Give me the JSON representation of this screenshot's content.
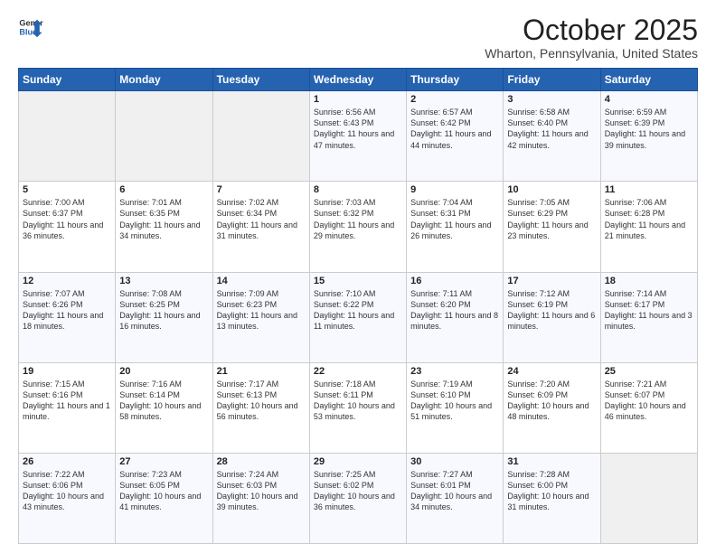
{
  "logo": {
    "line1": "General",
    "line2": "Blue"
  },
  "header": {
    "month": "October 2025",
    "location": "Wharton, Pennsylvania, United States"
  },
  "days_of_week": [
    "Sunday",
    "Monday",
    "Tuesday",
    "Wednesday",
    "Thursday",
    "Friday",
    "Saturday"
  ],
  "weeks": [
    [
      {
        "day": "",
        "info": ""
      },
      {
        "day": "",
        "info": ""
      },
      {
        "day": "",
        "info": ""
      },
      {
        "day": "1",
        "info": "Sunrise: 6:56 AM\nSunset: 6:43 PM\nDaylight: 11 hours and 47 minutes."
      },
      {
        "day": "2",
        "info": "Sunrise: 6:57 AM\nSunset: 6:42 PM\nDaylight: 11 hours and 44 minutes."
      },
      {
        "day": "3",
        "info": "Sunrise: 6:58 AM\nSunset: 6:40 PM\nDaylight: 11 hours and 42 minutes."
      },
      {
        "day": "4",
        "info": "Sunrise: 6:59 AM\nSunset: 6:39 PM\nDaylight: 11 hours and 39 minutes."
      }
    ],
    [
      {
        "day": "5",
        "info": "Sunrise: 7:00 AM\nSunset: 6:37 PM\nDaylight: 11 hours and 36 minutes."
      },
      {
        "day": "6",
        "info": "Sunrise: 7:01 AM\nSunset: 6:35 PM\nDaylight: 11 hours and 34 minutes."
      },
      {
        "day": "7",
        "info": "Sunrise: 7:02 AM\nSunset: 6:34 PM\nDaylight: 11 hours and 31 minutes."
      },
      {
        "day": "8",
        "info": "Sunrise: 7:03 AM\nSunset: 6:32 PM\nDaylight: 11 hours and 29 minutes."
      },
      {
        "day": "9",
        "info": "Sunrise: 7:04 AM\nSunset: 6:31 PM\nDaylight: 11 hours and 26 minutes."
      },
      {
        "day": "10",
        "info": "Sunrise: 7:05 AM\nSunset: 6:29 PM\nDaylight: 11 hours and 23 minutes."
      },
      {
        "day": "11",
        "info": "Sunrise: 7:06 AM\nSunset: 6:28 PM\nDaylight: 11 hours and 21 minutes."
      }
    ],
    [
      {
        "day": "12",
        "info": "Sunrise: 7:07 AM\nSunset: 6:26 PM\nDaylight: 11 hours and 18 minutes."
      },
      {
        "day": "13",
        "info": "Sunrise: 7:08 AM\nSunset: 6:25 PM\nDaylight: 11 hours and 16 minutes."
      },
      {
        "day": "14",
        "info": "Sunrise: 7:09 AM\nSunset: 6:23 PM\nDaylight: 11 hours and 13 minutes."
      },
      {
        "day": "15",
        "info": "Sunrise: 7:10 AM\nSunset: 6:22 PM\nDaylight: 11 hours and 11 minutes."
      },
      {
        "day": "16",
        "info": "Sunrise: 7:11 AM\nSunset: 6:20 PM\nDaylight: 11 hours and 8 minutes."
      },
      {
        "day": "17",
        "info": "Sunrise: 7:12 AM\nSunset: 6:19 PM\nDaylight: 11 hours and 6 minutes."
      },
      {
        "day": "18",
        "info": "Sunrise: 7:14 AM\nSunset: 6:17 PM\nDaylight: 11 hours and 3 minutes."
      }
    ],
    [
      {
        "day": "19",
        "info": "Sunrise: 7:15 AM\nSunset: 6:16 PM\nDaylight: 11 hours and 1 minute."
      },
      {
        "day": "20",
        "info": "Sunrise: 7:16 AM\nSunset: 6:14 PM\nDaylight: 10 hours and 58 minutes."
      },
      {
        "day": "21",
        "info": "Sunrise: 7:17 AM\nSunset: 6:13 PM\nDaylight: 10 hours and 56 minutes."
      },
      {
        "day": "22",
        "info": "Sunrise: 7:18 AM\nSunset: 6:11 PM\nDaylight: 10 hours and 53 minutes."
      },
      {
        "day": "23",
        "info": "Sunrise: 7:19 AM\nSunset: 6:10 PM\nDaylight: 10 hours and 51 minutes."
      },
      {
        "day": "24",
        "info": "Sunrise: 7:20 AM\nSunset: 6:09 PM\nDaylight: 10 hours and 48 minutes."
      },
      {
        "day": "25",
        "info": "Sunrise: 7:21 AM\nSunset: 6:07 PM\nDaylight: 10 hours and 46 minutes."
      }
    ],
    [
      {
        "day": "26",
        "info": "Sunrise: 7:22 AM\nSunset: 6:06 PM\nDaylight: 10 hours and 43 minutes."
      },
      {
        "day": "27",
        "info": "Sunrise: 7:23 AM\nSunset: 6:05 PM\nDaylight: 10 hours and 41 minutes."
      },
      {
        "day": "28",
        "info": "Sunrise: 7:24 AM\nSunset: 6:03 PM\nDaylight: 10 hours and 39 minutes."
      },
      {
        "day": "29",
        "info": "Sunrise: 7:25 AM\nSunset: 6:02 PM\nDaylight: 10 hours and 36 minutes."
      },
      {
        "day": "30",
        "info": "Sunrise: 7:27 AM\nSunset: 6:01 PM\nDaylight: 10 hours and 34 minutes."
      },
      {
        "day": "31",
        "info": "Sunrise: 7:28 AM\nSunset: 6:00 PM\nDaylight: 10 hours and 31 minutes."
      },
      {
        "day": "",
        "info": ""
      }
    ]
  ]
}
